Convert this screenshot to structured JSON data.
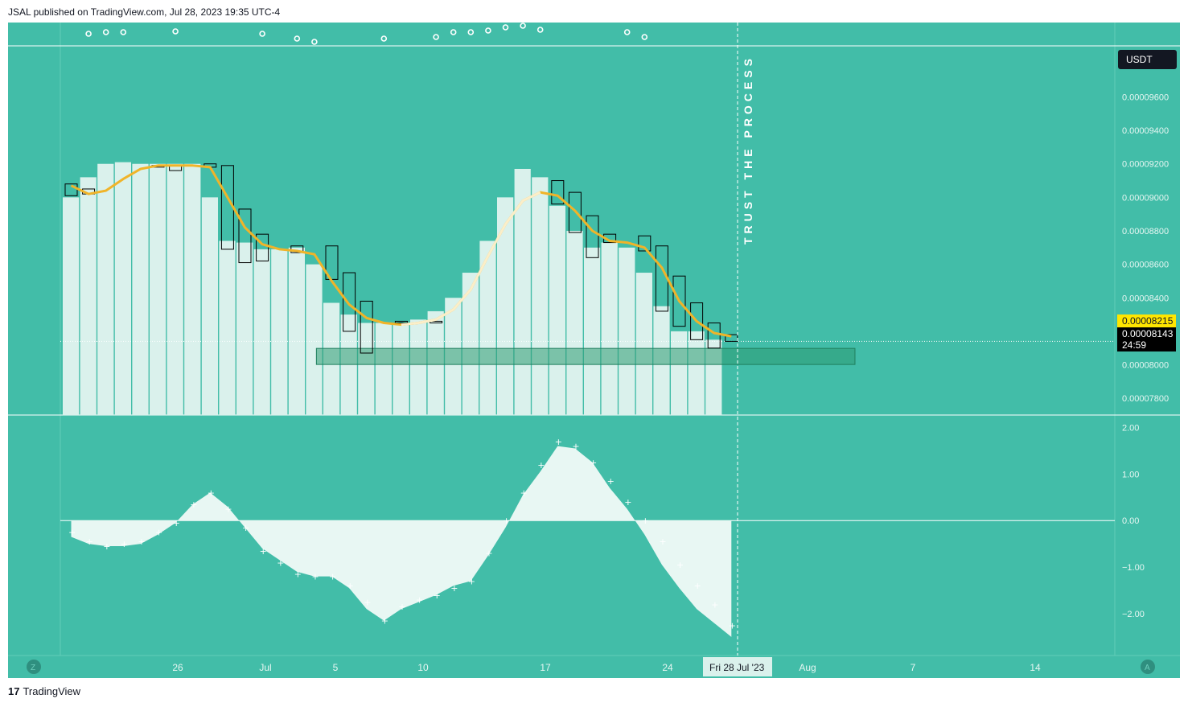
{
  "header": {
    "published": "JSAL published on TradingView.com, Jul 28, 2023 19:35 UTC-4"
  },
  "footer": {
    "brand": "TradingView",
    "logo_glyph": "17"
  },
  "colors": {
    "background": "#42bda8",
    "bar": "#daf1ec",
    "ma": "#f0b429",
    "ma_light": "#fbeec9",
    "zone": "#2e9b73"
  },
  "currency_badge": "USDT",
  "vertical_note": "TRUST THE PROCESS",
  "price_badges": {
    "ma_value": "0.00008215",
    "last_price": "0.00008143",
    "countdown": "24:59"
  },
  "bottom_buttons": {
    "left": "Z",
    "right": "A"
  },
  "date_badge": "Fri 28 Jul '23",
  "chart_data": [
    {
      "type": "bar",
      "title": "",
      "price_axis": {
        "ticks": [
          "0.00009600",
          "0.00009400",
          "0.00009200",
          "0.00009000",
          "0.00008800",
          "0.00008600",
          "0.00008400",
          "0.00008000",
          "0.00007800"
        ],
        "ylim": [
          7.7e-05,
          9.9e-05
        ]
      },
      "x_axis": {
        "ticks": [
          "26",
          "Jul",
          "5",
          "10",
          "17",
          "24",
          "Aug",
          "7",
          "14"
        ]
      },
      "bar_heights": [
        9e-05,
        9.12e-05,
        9.2e-05,
        9.21e-05,
        9.2e-05,
        9.2e-05,
        9.2e-05,
        9.2e-05,
        9e-05,
        8.74e-05,
        8.73e-05,
        8.69e-05,
        8.69e-05,
        8.7e-05,
        8.6e-05,
        8.37e-05,
        8.3e-05,
        8.25e-05,
        8.25e-05,
        8.25e-05,
        8.27e-05,
        8.32e-05,
        8.4e-05,
        8.55e-05,
        8.74e-05,
        9e-05,
        9.17e-05,
        9.12e-05,
        8.95e-05,
        8.8e-05,
        8.7e-05,
        8.73e-05,
        8.7e-05,
        8.55e-05,
        8.35e-05,
        8.2e-05,
        8.2e-05,
        8.15e-05
      ],
      "candles": [
        {
          "i": 0,
          "o": 9.08e-05,
          "c": 9.01e-05
        },
        {
          "i": 1,
          "o": 9.05e-05,
          "c": 9.02e-05
        },
        {
          "i": 5,
          "o": 9.19e-05,
          "c": 9.19e-05
        },
        {
          "i": 6,
          "o": 9.19e-05,
          "c": 9.16e-05
        },
        {
          "i": 8,
          "o": 9.2e-05,
          "c": 9.18e-05
        },
        {
          "i": 9,
          "o": 9.19e-05,
          "c": 8.69e-05
        },
        {
          "i": 10,
          "o": 8.93e-05,
          "c": 8.61e-05
        },
        {
          "i": 11,
          "o": 8.78e-05,
          "c": 8.62e-05
        },
        {
          "i": 13,
          "o": 8.71e-05,
          "c": 8.67e-05
        },
        {
          "i": 15,
          "o": 8.71e-05,
          "c": 8.51e-05
        },
        {
          "i": 16,
          "o": 8.55e-05,
          "c": 8.2e-05
        },
        {
          "i": 17,
          "o": 8.38e-05,
          "c": 8.07e-05
        },
        {
          "i": 19,
          "o": 8.26e-05,
          "c": 8.25e-05
        },
        {
          "i": 21,
          "o": 8.26e-05,
          "c": 8.25e-05
        },
        {
          "i": 28,
          "o": 9.1e-05,
          "c": 8.96e-05
        },
        {
          "i": 29,
          "o": 9.03e-05,
          "c": 8.79e-05
        },
        {
          "i": 30,
          "o": 8.89e-05,
          "c": 8.64e-05
        },
        {
          "i": 31,
          "o": 8.78e-05,
          "c": 8.73e-05
        },
        {
          "i": 33,
          "o": 8.77e-05,
          "c": 8.68e-05
        },
        {
          "i": 34,
          "o": 8.71e-05,
          "c": 8.32e-05
        },
        {
          "i": 35,
          "o": 8.53e-05,
          "c": 8.23e-05
        },
        {
          "i": 36,
          "o": 8.37e-05,
          "c": 8.15e-05
        },
        {
          "i": 37,
          "o": 8.25e-05,
          "c": 8.1e-05
        },
        {
          "i": 38,
          "o": 8.18e-05,
          "c": 8.14e-05
        }
      ],
      "moving_average": [
        9.07e-05,
        9.02e-05,
        9.04e-05,
        9.11e-05,
        9.17e-05,
        9.19e-05,
        9.19e-05,
        9.19e-05,
        9.18e-05,
        9e-05,
        8.82e-05,
        8.72e-05,
        8.69e-05,
        8.68e-05,
        8.66e-05,
        8.5e-05,
        8.36e-05,
        8.28e-05,
        8.25e-05,
        8.24e-05,
        8.25e-05,
        8.27e-05,
        8.33e-05,
        8.45e-05,
        8.65e-05,
        8.84e-05,
        8.98e-05,
        9.03e-05,
        9.01e-05,
        8.92e-05,
        8.8e-05,
        8.74e-05,
        8.73e-05,
        8.7e-05,
        8.58e-05,
        8.38e-05,
        8.26e-05,
        8.19e-05,
        8.17e-05
      ],
      "ma_highlight_indices": [
        19,
        20,
        21,
        22,
        23,
        24,
        25,
        26,
        27
      ],
      "zone": {
        "from_index": 14.6,
        "to_index": 45.6,
        "low": 8e-05,
        "high": 8.05e-05
      },
      "last_price": 8.14e-05,
      "top_markers": [
        0.5,
        0.6,
        0.6,
        0.65,
        0.5,
        0.2,
        0.0,
        0.2,
        0.3,
        0.6,
        0.6,
        0.7,
        0.9,
        1.0,
        0.75,
        0.6,
        0.3
      ],
      "top_marker_indices": [
        1,
        2,
        3,
        6,
        11,
        13,
        14,
        18,
        21,
        22,
        23,
        24,
        25,
        26,
        27,
        32,
        33
      ]
    },
    {
      "type": "area",
      "title": "",
      "y_axis": {
        "ticks": [
          "2.00",
          "1.00",
          "0.00",
          "−1.00",
          "−2.00"
        ],
        "ylim": [
          -2.9,
          2.25
        ]
      },
      "values": [
        -0.35,
        -0.5,
        -0.55,
        -0.55,
        -0.5,
        -0.3,
        -0.05,
        0.35,
        0.6,
        0.3,
        -0.15,
        -0.6,
        -0.85,
        -1.1,
        -1.2,
        -1.2,
        -1.45,
        -1.9,
        -2.15,
        -1.9,
        -1.75,
        -1.6,
        -1.4,
        -1.3,
        -0.75,
        -0.15,
        0.55,
        1.05,
        1.6,
        1.55,
        1.25,
        0.7,
        0.25,
        -0.3,
        -0.95,
        -1.45,
        -1.9,
        -2.2,
        -2.5
      ],
      "dots": [
        -0.25,
        -0.45,
        -0.55,
        -0.5,
        -0.45,
        -0.25,
        -0.05,
        0.35,
        0.6,
        0.25,
        -0.15,
        -0.65,
        -0.9,
        -1.15,
        -1.2,
        -1.2,
        -1.4,
        -1.75,
        -2.15,
        -1.85,
        -1.7,
        -1.6,
        -1.45,
        -1.3,
        -0.7,
        0.0,
        0.6,
        1.2,
        1.7,
        1.6,
        1.25,
        0.85,
        0.4,
        0.0,
        -0.45,
        -0.95,
        -1.4,
        -1.8,
        -2.25
      ]
    }
  ]
}
